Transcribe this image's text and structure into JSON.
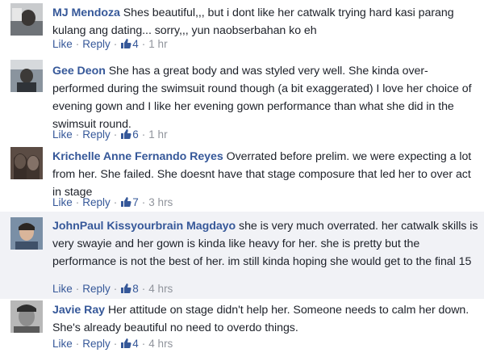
{
  "comments": [
    {
      "author": "MJ Mendoza",
      "text": "Shes beautiful,,, but i dont like her catwalk trying hard kasi parang kulang ang dating... sorry,,, yun naobserbahan ko eh",
      "like_label": "Like",
      "reply_label": "Reply",
      "like_count": "4",
      "time": "1 hr"
    },
    {
      "author": "Gee Deon",
      "text": "She has a great body and was styled very well. She kinda over-performed during the swimsuit round though (a bit exaggerated) I love her choice of evening gown and I like her evening gown performance than what she did in the swimsuit round.",
      "like_label": "Like",
      "reply_label": "Reply",
      "like_count": "6",
      "time": "1 hr"
    },
    {
      "author": "Krichelle Anne Fernando Reyes",
      "text": "Overrated before prelim. we were expecting a lot from her. She failed. She doesnt have that stage composure that led her to over act in stage",
      "like_label": "Like",
      "reply_label": "Reply",
      "like_count": "7",
      "time": "3 hrs"
    },
    {
      "author": "JohnPaul Kissyourbrain Magdayo",
      "text": "she is very much overrated. her catwalk skills is very swayie and her gown is kinda like heavy for her. she is pretty but the performance is not the best of her. im still kinda hoping she would get to the final 15",
      "like_label": "Like",
      "reply_label": "Reply",
      "like_count": "8",
      "time": "4 hrs"
    },
    {
      "author": "Javie Ray",
      "text": "Her attitude on stage didn't help her. Someone needs to calm her down. She's already beautiful no need to overdo things.",
      "like_label": "Like",
      "reply_label": "Reply",
      "like_count": "4",
      "time": "4 hrs"
    }
  ],
  "icons": {
    "like": "thumbs-up-icon"
  },
  "colors": {
    "author": "#365899",
    "link": "#365899",
    "text": "#1d2129",
    "meta": "#90949c",
    "highlight_bg": "#f1f2f6"
  }
}
